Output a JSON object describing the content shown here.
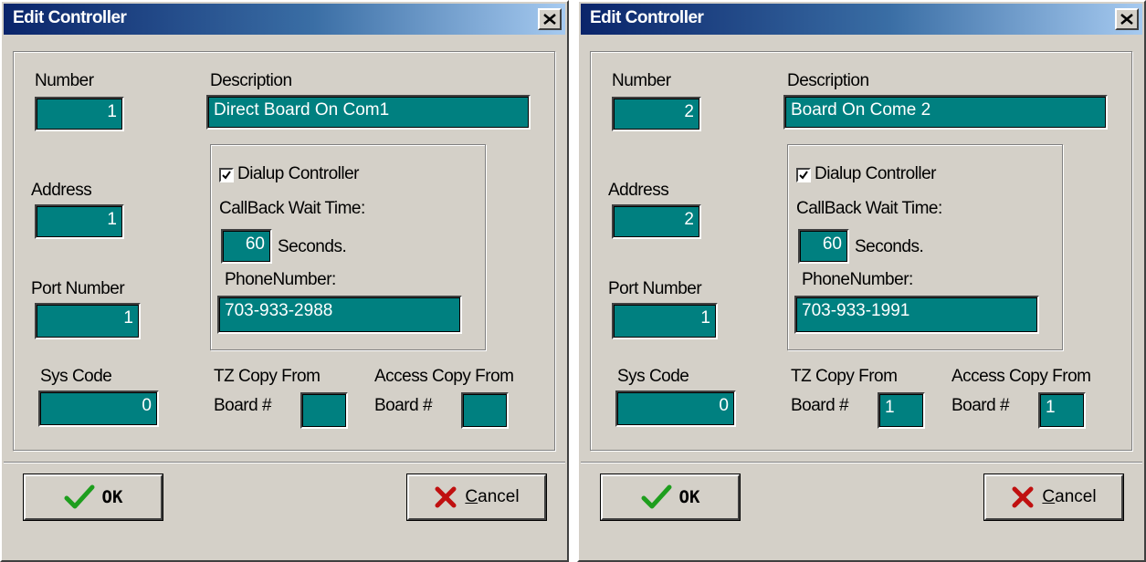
{
  "dialogs": [
    {
      "title": "Edit Controller",
      "labels": {
        "number": "Number",
        "description": "Description",
        "address": "Address",
        "port_number": "Port Number",
        "sys_code": "Sys Code",
        "dialup": "Dialup Controller",
        "callback_wait": "CallBack Wait Time:",
        "seconds": "Seconds.",
        "phone_number": "PhoneNumber:",
        "tz_copy_from": "TZ Copy From",
        "access_copy_from": "Access Copy From",
        "board_hash": "Board #"
      },
      "values": {
        "number": "1",
        "description": "Direct Board On Com1",
        "address": "1",
        "port_number": "1",
        "sys_code": "0",
        "dialup_checked": true,
        "callback_wait": "60",
        "phone_number": "703-933-2988",
        "tz_board": "",
        "access_board": ""
      },
      "buttons": {
        "ok": "OK",
        "cancel_first": "C",
        "cancel_rest": "ancel"
      }
    },
    {
      "title": "Edit Controller",
      "labels": {
        "number": "Number",
        "description": "Description",
        "address": "Address",
        "port_number": "Port Number",
        "sys_code": "Sys Code",
        "dialup": "Dialup Controller",
        "callback_wait": "CallBack Wait Time:",
        "seconds": "Seconds.",
        "phone_number": "PhoneNumber:",
        "tz_copy_from": "TZ Copy From",
        "access_copy_from": "Access Copy From",
        "board_hash": "Board #"
      },
      "values": {
        "number": "2",
        "description": "Board  On Come 2",
        "address": "2",
        "port_number": "1",
        "sys_code": "0",
        "dialup_checked": true,
        "callback_wait": "60",
        "phone_number": "703-933-1991",
        "tz_board": "1",
        "access_board": "1"
      },
      "buttons": {
        "ok": "OK",
        "cancel_first": "C",
        "cancel_rest": "ancel"
      }
    }
  ],
  "colors": {
    "field_bg": "#008080",
    "dialog_bg": "#d4d0c8",
    "title_start": "#0a246a",
    "title_end": "#a6caf0"
  },
  "icons": {
    "close": "close-icon",
    "ok": "checkmark-icon",
    "cancel": "x-icon"
  }
}
